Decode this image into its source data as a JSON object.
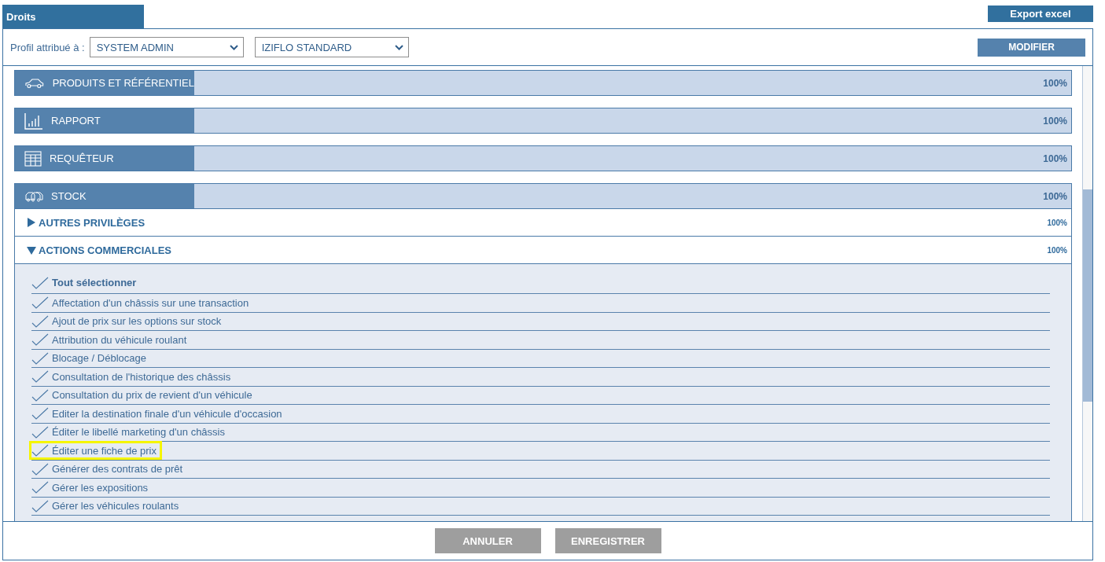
{
  "tab": {
    "label": "Droits",
    "selected": true
  },
  "export_button": "Export excel",
  "profile": {
    "label": "Profil attribué à :",
    "selects": [
      "SYSTEM ADMIN",
      "IZIFLO STANDARD"
    ]
  },
  "modify_button": "MODIFIER",
  "modules": [
    {
      "kind": "car",
      "label": "PRODUITS ET RÉFÉRENTIEL",
      "percent": "100%"
    },
    {
      "kind": "chart",
      "label": "RAPPORT",
      "percent": "100%"
    },
    {
      "kind": "grid",
      "label": "REQUÊTEUR",
      "percent": "100%"
    },
    {
      "kind": "vans",
      "label": "STOCK",
      "percent": "100%",
      "children": [
        {
          "label": "AUTRES PRIVILÈGES",
          "percent": "100%",
          "expanded": false
        },
        {
          "label": "ACTIONS COMMERCIALES",
          "percent": "100%",
          "expanded": true,
          "select_all": {
            "label": "Tout sélectionner",
            "checked": true
          },
          "items": [
            {
              "label": "Affectation d'un châssis sur une transaction",
              "checked": true,
              "highlighted": false
            },
            {
              "label": "Ajout de prix sur les options sur stock",
              "checked": true,
              "highlighted": false
            },
            {
              "label": "Attribution du véhicule roulant",
              "checked": true,
              "highlighted": false
            },
            {
              "label": "Blocage / Déblocage",
              "checked": true,
              "highlighted": false
            },
            {
              "label": "Consultation de l'historique des châssis",
              "checked": true,
              "highlighted": false
            },
            {
              "label": "Consultation du prix de revient d'un véhicule",
              "checked": true,
              "highlighted": false
            },
            {
              "label": "Editer la destination finale d'un véhicule d'occasion",
              "checked": true,
              "highlighted": false
            },
            {
              "label": "Éditer le libellé marketing d'un châssis",
              "checked": true,
              "highlighted": false
            },
            {
              "label": "Éditer une fiche de prix",
              "checked": true,
              "highlighted": true
            },
            {
              "label": "Générer des contrats de prêt",
              "checked": true,
              "highlighted": false
            },
            {
              "label": "Gérer les expositions",
              "checked": true,
              "highlighted": false
            },
            {
              "label": "Gérer les véhicules roulants",
              "checked": true,
              "highlighted": false
            }
          ]
        }
      ]
    }
  ],
  "footer_buttons": [
    "ANNULER",
    "ENREGISTRER"
  ]
}
